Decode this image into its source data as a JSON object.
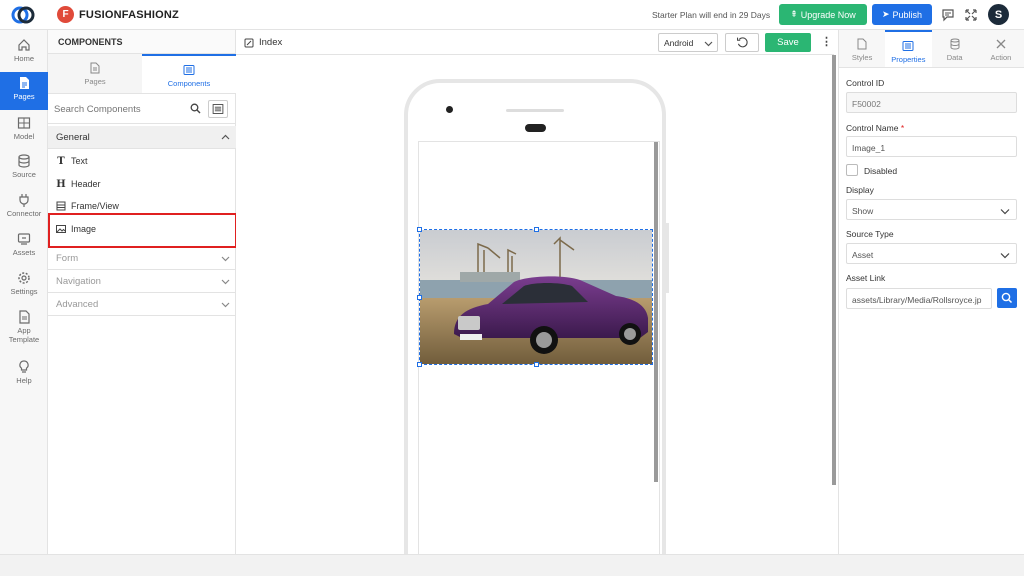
{
  "header": {
    "brand_initial": "F",
    "brand_name": "FUSIONFASHIONZ",
    "plan_text": "Starter Plan will end in 29 Days",
    "upgrade_label": "Upgrade Now",
    "publish_label": "Publish",
    "avatar_initial": "S",
    "colors": {
      "upgrade": "#2bb673",
      "publish": "#1f6fe5",
      "brand": "#e04a3a"
    }
  },
  "leftnav": {
    "items": [
      {
        "label": "Home",
        "icon": "home-icon"
      },
      {
        "label": "Pages",
        "icon": "page-icon",
        "active": true
      },
      {
        "label": "Model",
        "icon": "table-icon"
      },
      {
        "label": "Source",
        "icon": "database-icon"
      },
      {
        "label": "Connector",
        "icon": "plug-icon"
      },
      {
        "label": "Assets",
        "icon": "assets-icon"
      },
      {
        "label": "Settings",
        "icon": "gear-icon"
      },
      {
        "label": "App",
        "label2": "Template",
        "icon": "template-icon"
      },
      {
        "label": "Help",
        "icon": "lightbulb-icon"
      }
    ]
  },
  "components": {
    "title": "COMPONENTS",
    "tabs": [
      {
        "label": "Pages"
      },
      {
        "label": "Components",
        "active": true
      }
    ],
    "search_placeholder": "Search Components",
    "sections": {
      "general": "General",
      "form": "Form",
      "navigation": "Navigation",
      "advanced": "Advanced"
    },
    "items": [
      {
        "label": "Text",
        "icon": "text-icon"
      },
      {
        "label": "Header",
        "icon": "header-icon"
      },
      {
        "label": "Frame/View",
        "icon": "frame-icon"
      },
      {
        "label": "Image",
        "icon": "image-icon"
      }
    ]
  },
  "canvas": {
    "page_name": "Index",
    "platform": "Android",
    "save_label": "Save"
  },
  "properties": {
    "tabs": [
      {
        "label": "Styles",
        "icon": "styles-icon"
      },
      {
        "label": "Properties",
        "icon": "list-icon",
        "active": true
      },
      {
        "label": "Data",
        "icon": "database-icon"
      },
      {
        "label": "Action",
        "icon": "tools-icon"
      }
    ],
    "control_id_label": "Control ID",
    "control_id_value": "F50002",
    "control_name_label": "Control Name",
    "control_name_required": "*",
    "control_name_value": "Image_1",
    "disabled_label": "Disabled",
    "display_label": "Display",
    "display_value": "Show",
    "source_type_label": "Source Type",
    "source_type_value": "Asset",
    "asset_link_label": "Asset Link",
    "asset_link_value": "assets/Library/Media/Rollsroyce.jp"
  }
}
